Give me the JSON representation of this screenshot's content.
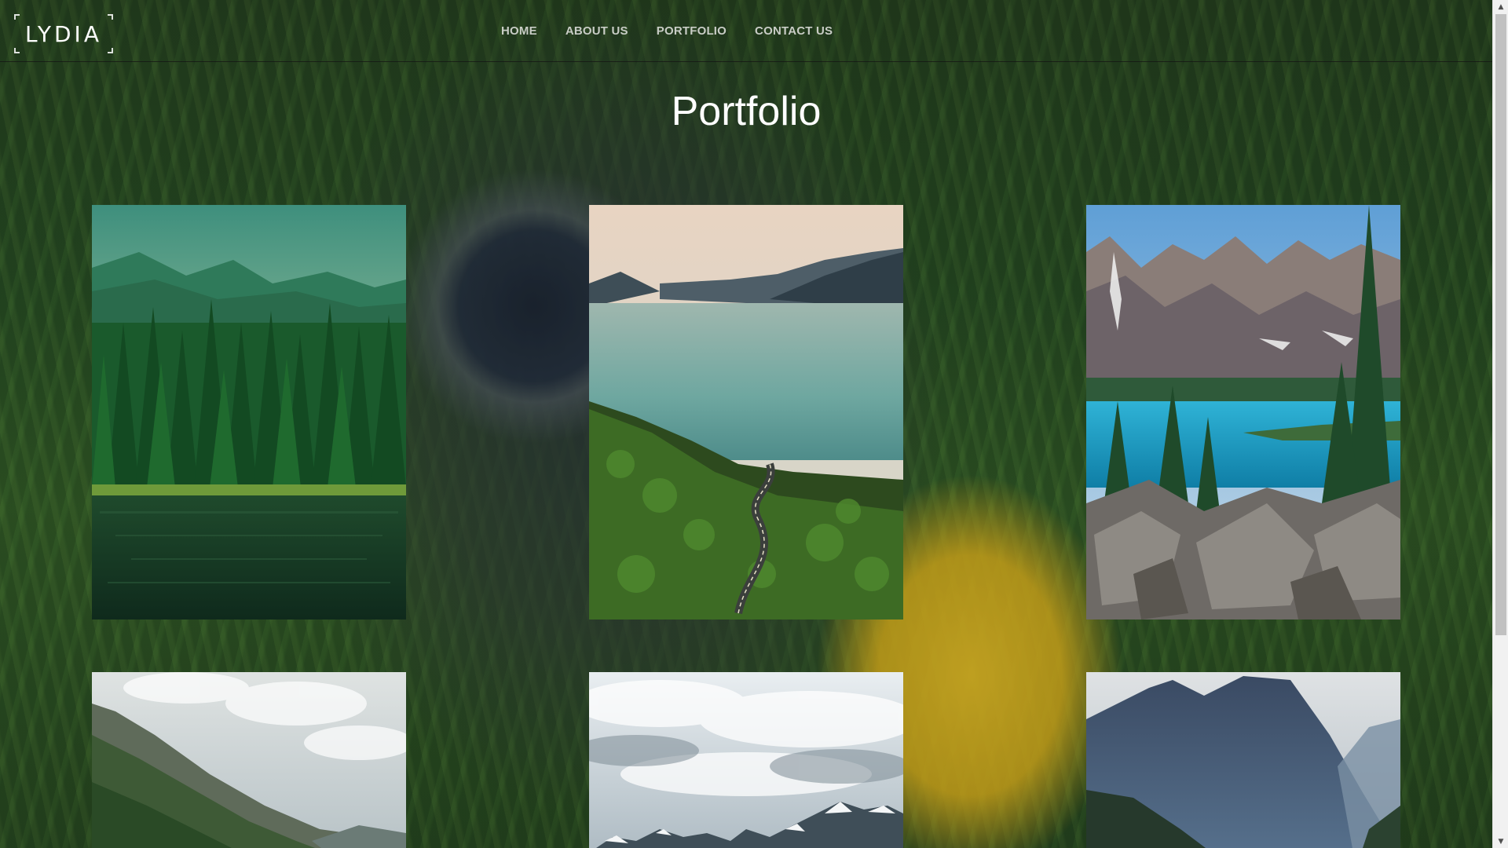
{
  "brand": {
    "logo_text": "LYDIA"
  },
  "nav": {
    "items": [
      {
        "label": "HOME"
      },
      {
        "label": "ABOUT US"
      },
      {
        "label": "PORTFOLIO"
      },
      {
        "label": "CONTACT US"
      }
    ]
  },
  "main": {
    "title": "Portfolio"
  },
  "gallery": {
    "photos": [
      {
        "subject": "forest-lake"
      },
      {
        "subject": "lake-and-winding-road"
      },
      {
        "subject": "turquoise-mountain-lake"
      },
      {
        "subject": "green-mountain-slope"
      },
      {
        "subject": "snowy-peaks-in-clouds"
      },
      {
        "subject": "blue-mountain-cliff"
      }
    ]
  },
  "colors": {
    "nav_text": "#c9cdc6",
    "title_text": "#ffffff",
    "accent_dandelion": "#f2c828"
  },
  "icons": {
    "scroll_up": "triangle-up-icon",
    "scroll_down": "triangle-down-icon"
  }
}
